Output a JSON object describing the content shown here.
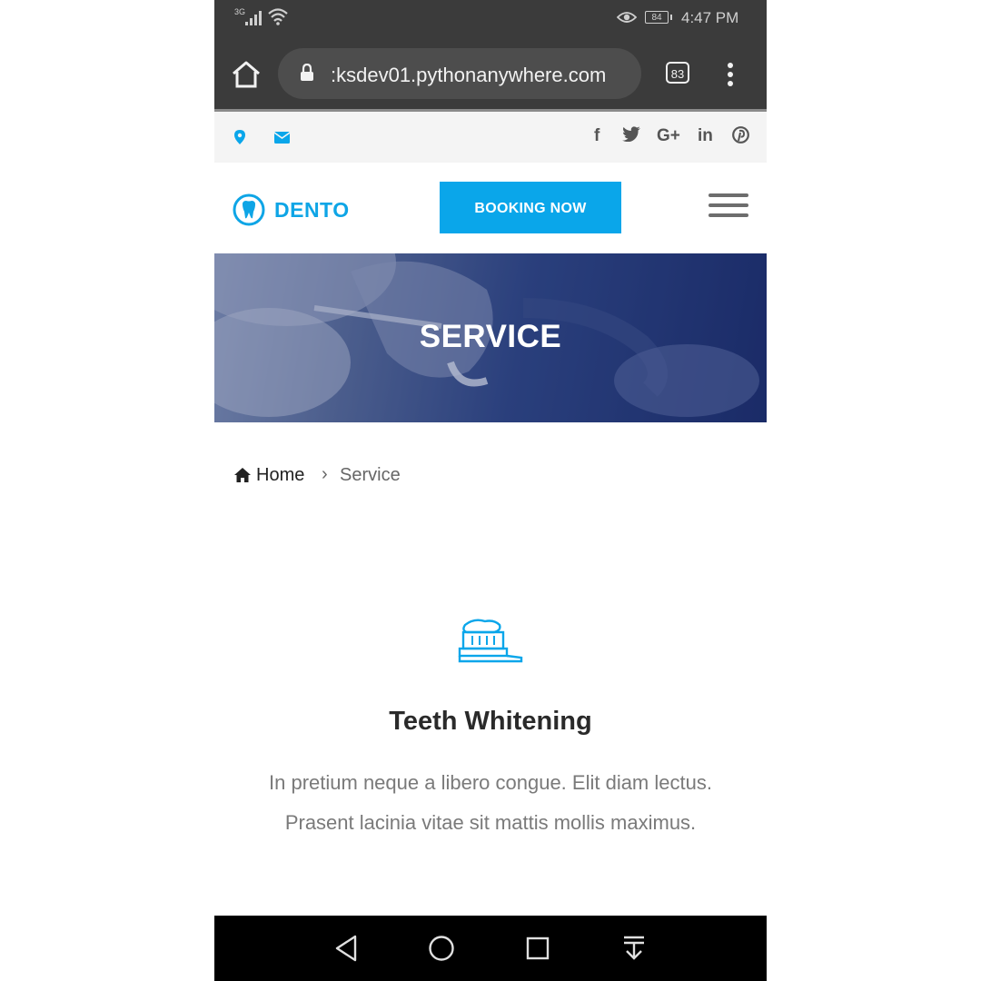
{
  "status_bar": {
    "network": "3G",
    "battery": "84",
    "time": "4:47 PM"
  },
  "browser": {
    "url": ":ksdev01.pythonanywhere.com",
    "tab_count": "83"
  },
  "info_bar": {
    "social": [
      "f",
      "t",
      "G+",
      "in",
      "p"
    ]
  },
  "header": {
    "logo_text": "DENTO",
    "booking_label": "BOOKING NOW"
  },
  "hero": {
    "title": "SERVICE"
  },
  "breadcrumb": {
    "home": "Home",
    "separator": "›",
    "current": "Service"
  },
  "service": {
    "title": "Teeth Whitening",
    "description": "In pretium neque a libero congue. Elit diam lectus. Prasent lacinia vitae sit mattis mollis maximus."
  },
  "colors": {
    "accent": "#0aa6ea",
    "status_bar_bg": "#3b3b3b",
    "nav_bar_bg": "#000000"
  }
}
